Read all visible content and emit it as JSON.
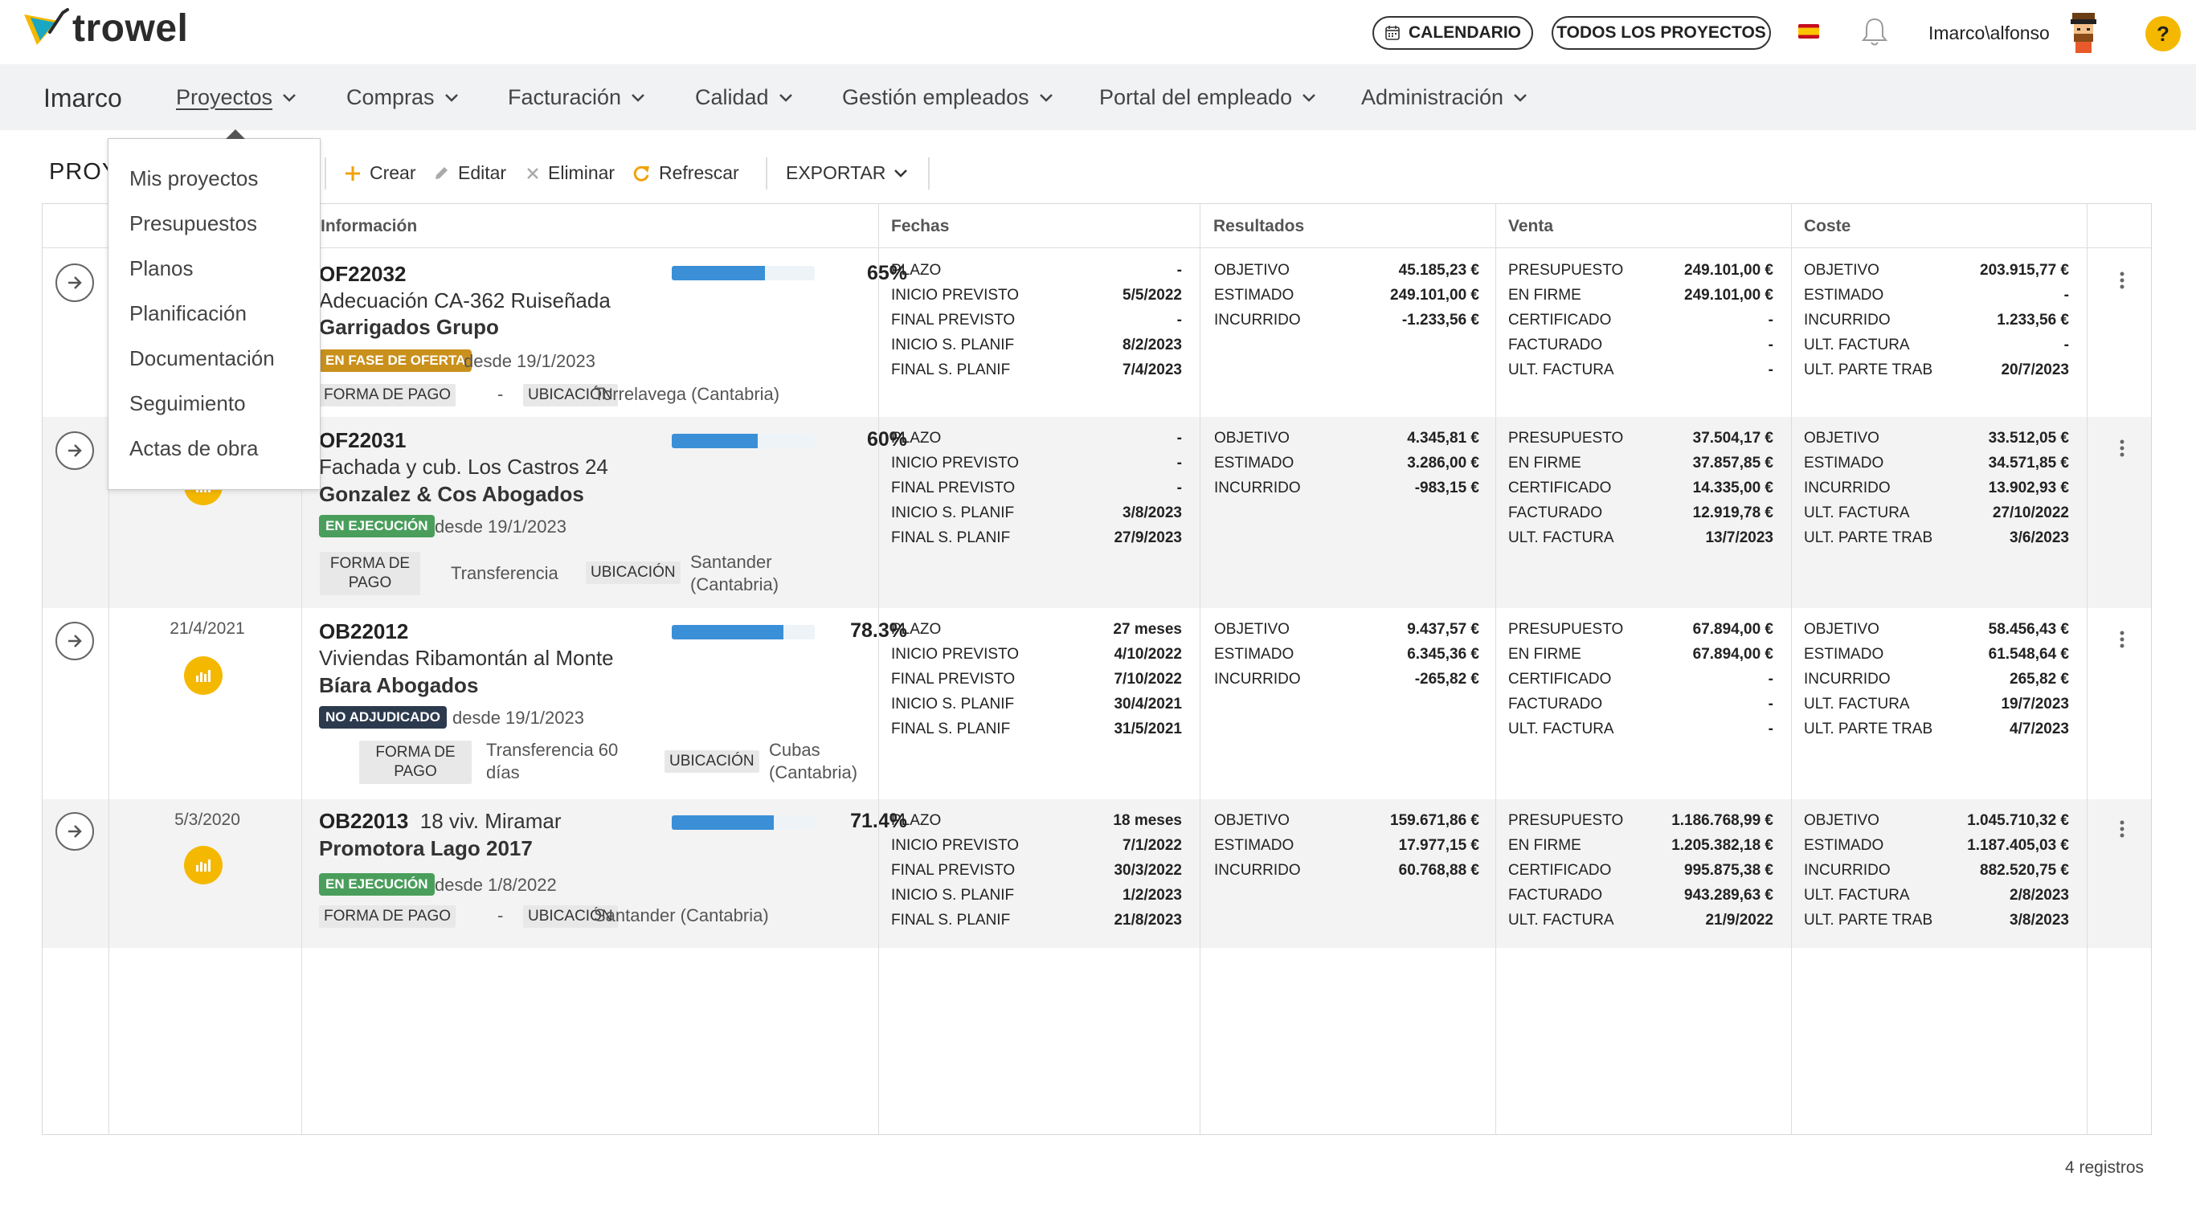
{
  "header": {
    "logo_text": "trowel",
    "calendar_button": "CALENDARIO",
    "all_projects_button": "TODOS LOS PROYECTOS",
    "user": "Imarco\\alfonso",
    "help": "?"
  },
  "nav": {
    "brand": "Imarco",
    "items": [
      {
        "label": "Proyectos"
      },
      {
        "label": "Compras"
      },
      {
        "label": "Facturación"
      },
      {
        "label": "Calidad"
      },
      {
        "label": "Gestión empleados"
      },
      {
        "label": "Portal del empleado"
      },
      {
        "label": "Administración"
      }
    ]
  },
  "dropdown": {
    "items": [
      "Mis proyectos",
      "Presupuestos",
      "Planos",
      "Planificación",
      "Documentación",
      "Seguimiento",
      "Actas de obra"
    ]
  },
  "toolbar": {
    "title": "PROY",
    "create": "Crear",
    "edit": "Editar",
    "delete": "Eliminar",
    "refresh": "Refrescar",
    "export": "EXPORTAR"
  },
  "table": {
    "headers": {
      "info": "Información",
      "dates": "Fechas",
      "results": "Resultados",
      "sale": "Venta",
      "cost": "Coste"
    },
    "rows": [
      {
        "date": "",
        "code": "OF22032",
        "name_inline": "",
        "name": "Adecuación CA-362 Ruiseñada",
        "client": "Garrigados Grupo",
        "progress": 0.65,
        "progress_label": "65%",
        "badge": "EN FASE DE OFERTA",
        "badge_color": "#c9901b",
        "since": "desde 19/1/2023",
        "payment_tag": "FORMA DE PAGO",
        "payment": "-",
        "location_tag": "UBICACIÓN",
        "location": "Torrelavega (Cantabria)",
        "fechas": [
          [
            "PLAZO",
            "-"
          ],
          [
            "INICIO PREVISTO",
            "5/5/2022"
          ],
          [
            "FINAL PREVISTO",
            "-"
          ],
          [
            "INICIO S. PLANIF",
            "8/2/2023"
          ],
          [
            "FINAL S. PLANIF",
            "7/4/2023"
          ]
        ],
        "resultados": [
          [
            "OBJETIVO",
            "45.185,23 €"
          ],
          [
            "ESTIMADO",
            "249.101,00 €"
          ],
          [
            "INCURRIDO",
            "-1.233,56 €"
          ]
        ],
        "venta": [
          [
            "PRESUPUESTO",
            "249.101,00 €"
          ],
          [
            "EN FIRME",
            "249.101,00 €"
          ],
          [
            "CERTIFICADO",
            "-"
          ],
          [
            "FACTURADO",
            "-"
          ],
          [
            "ULT. FACTURA",
            "-"
          ]
        ],
        "coste": [
          [
            "OBJETIVO",
            "203.915,77 €"
          ],
          [
            "ESTIMADO",
            "-"
          ],
          [
            "INCURRIDO",
            "1.233,56 €"
          ],
          [
            "ULT. FACTURA",
            "-"
          ],
          [
            "ULT. PARTE TRAB",
            "20/7/2023"
          ]
        ]
      },
      {
        "date": "",
        "code": "OF22031",
        "name_inline": "",
        "name": "Fachada y cub. Los Castros 24",
        "client": "Gonzalez & Cos Abogados",
        "progress": 0.6,
        "progress_label": "60%",
        "badge": "EN EJECUCIÓN",
        "badge_color": "#4a9e5c",
        "since": "desde 19/1/2023",
        "payment_tag": "FORMA DE PAGO",
        "payment": "Transferencia",
        "location_tag": "UBICACIÓN",
        "location": "Santander (Cantabria)",
        "fechas": [
          [
            "PLAZO",
            "-"
          ],
          [
            "INICIO PREVISTO",
            "-"
          ],
          [
            "FINAL PREVISTO",
            "-"
          ],
          [
            "INICIO S. PLANIF",
            "3/8/2023"
          ],
          [
            "FINAL S. PLANIF",
            "27/9/2023"
          ]
        ],
        "resultados": [
          [
            "OBJETIVO",
            "4.345,81 €"
          ],
          [
            "ESTIMADO",
            "3.286,00 €"
          ],
          [
            "INCURRIDO",
            "-983,15 €"
          ]
        ],
        "venta": [
          [
            "PRESUPUESTO",
            "37.504,17 €"
          ],
          [
            "EN FIRME",
            "37.857,85 €"
          ],
          [
            "CERTIFICADO",
            "14.335,00 €"
          ],
          [
            "FACTURADO",
            "12.919,78 €"
          ],
          [
            "ULT. FACTURA",
            "13/7/2023"
          ]
        ],
        "coste": [
          [
            "OBJETIVO",
            "33.512,05 €"
          ],
          [
            "ESTIMADO",
            "34.571,85 €"
          ],
          [
            "INCURRIDO",
            "13.902,93 €"
          ],
          [
            "ULT. FACTURA",
            "27/10/2022"
          ],
          [
            "ULT. PARTE TRAB",
            "3/6/2023"
          ]
        ]
      },
      {
        "date": "21/4/2021",
        "code": "OB22012",
        "name_inline": "",
        "name": "Viviendas Ribamontán al Monte",
        "client": "Bíara Abogados",
        "progress": 0.783,
        "progress_label": "78.3%",
        "badge": "NO ADJUDICADO",
        "badge_color": "#2c3a4e",
        "since": "desde 19/1/2023",
        "payment_tag": "FORMA DE PAGO",
        "payment": "Transferencia 60 días",
        "location_tag": "UBICACIÓN",
        "location": "Cubas (Cantabria)",
        "fechas": [
          [
            "PLAZO",
            "27 meses"
          ],
          [
            "INICIO PREVISTO",
            "4/10/2022"
          ],
          [
            "FINAL PREVISTO",
            "7/10/2022"
          ],
          [
            "INICIO S. PLANIF",
            "30/4/2021"
          ],
          [
            "FINAL S. PLANIF",
            "31/5/2021"
          ]
        ],
        "resultados": [
          [
            "OBJETIVO",
            "9.437,57 €"
          ],
          [
            "ESTIMADO",
            "6.345,36 €"
          ],
          [
            "INCURRIDO",
            "-265,82 €"
          ]
        ],
        "venta": [
          [
            "PRESUPUESTO",
            "67.894,00 €"
          ],
          [
            "EN FIRME",
            "67.894,00 €"
          ],
          [
            "CERTIFICADO",
            "-"
          ],
          [
            "FACTURADO",
            "-"
          ],
          [
            "ULT. FACTURA",
            "-"
          ]
        ],
        "coste": [
          [
            "OBJETIVO",
            "58.456,43 €"
          ],
          [
            "ESTIMADO",
            "61.548,64 €"
          ],
          [
            "INCURRIDO",
            "265,82 €"
          ],
          [
            "ULT. FACTURA",
            "19/7/2023"
          ],
          [
            "ULT. PARTE TRAB",
            "4/7/2023"
          ]
        ]
      },
      {
        "date": "5/3/2020",
        "code": "OB22013",
        "name_inline": "18 viv. Miramar",
        "name": "",
        "client": "Promotora Lago 2017",
        "progress": 0.714,
        "progress_label": "71.4%",
        "badge": "EN EJECUCIÓN",
        "badge_color": "#4a9e5c",
        "since": "desde 1/8/2022",
        "payment_tag": "FORMA DE PAGO",
        "payment": "-",
        "location_tag": "UBICACIÓN",
        "location": "Santander (Cantabria)",
        "fechas": [
          [
            "PLAZO",
            "18 meses"
          ],
          [
            "INICIO PREVISTO",
            "7/1/2022"
          ],
          [
            "FINAL PREVISTO",
            "30/3/2022"
          ],
          [
            "INICIO S. PLANIF",
            "1/2/2023"
          ],
          [
            "FINAL S. PLANIF",
            "21/8/2023"
          ]
        ],
        "resultados": [
          [
            "OBJETIVO",
            "159.671,86 €"
          ],
          [
            "ESTIMADO",
            "17.977,15 €"
          ],
          [
            "INCURRIDO",
            "60.768,88 €"
          ]
        ],
        "venta": [
          [
            "PRESUPUESTO",
            "1.186.768,99 €"
          ],
          [
            "EN FIRME",
            "1.205.382,18 €"
          ],
          [
            "CERTIFICADO",
            "995.875,38 €"
          ],
          [
            "FACTURADO",
            "943.289,63 €"
          ],
          [
            "ULT. FACTURA",
            "21/9/2022"
          ]
        ],
        "coste": [
          [
            "OBJETIVO",
            "1.045.710,32 €"
          ],
          [
            "ESTIMADO",
            "1.187.405,03 €"
          ],
          [
            "INCURRIDO",
            "882.520,75 €"
          ],
          [
            "ULT. FACTURA",
            "2/8/2023"
          ],
          [
            "ULT. PARTE TRAB",
            "3/8/2023"
          ]
        ]
      }
    ],
    "records": "4 registros"
  }
}
